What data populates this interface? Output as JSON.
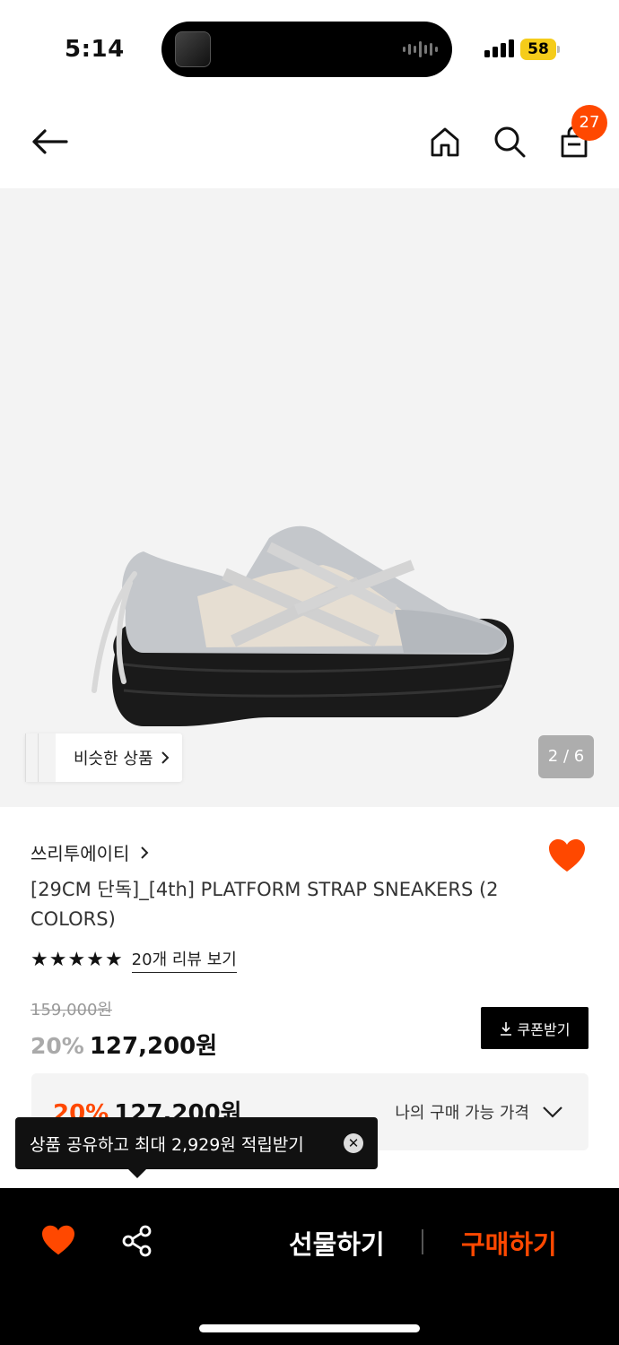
{
  "status_bar": {
    "time": "5:14",
    "battery": "58"
  },
  "header": {
    "cart_count": "27"
  },
  "gallery": {
    "similar_label": "비슷한 상품",
    "counter": "2 / 6"
  },
  "product": {
    "brand": "쓰리투에이티",
    "title": "[29CM 단독]_[4th] PLATFORM STRAP SNEAKERS (2 COLORS)",
    "rating_stars": 5,
    "review_link": "20개 리뷰 보기",
    "original_price": "159,000원",
    "discount": "20%",
    "price": "127,200원",
    "coupon_label": "쿠폰받기"
  },
  "my_price": {
    "discount": "20%",
    "price": "127,200원",
    "label": "나의 구매 가능 가격"
  },
  "tooltip": {
    "text": "상품 공유하고 최대 2,929원 적립받기"
  },
  "bottom_bar": {
    "gift_label": "선물하기",
    "buy_label": "구매하기"
  },
  "colors": {
    "accent": "#ff4800",
    "black": "#000000"
  }
}
